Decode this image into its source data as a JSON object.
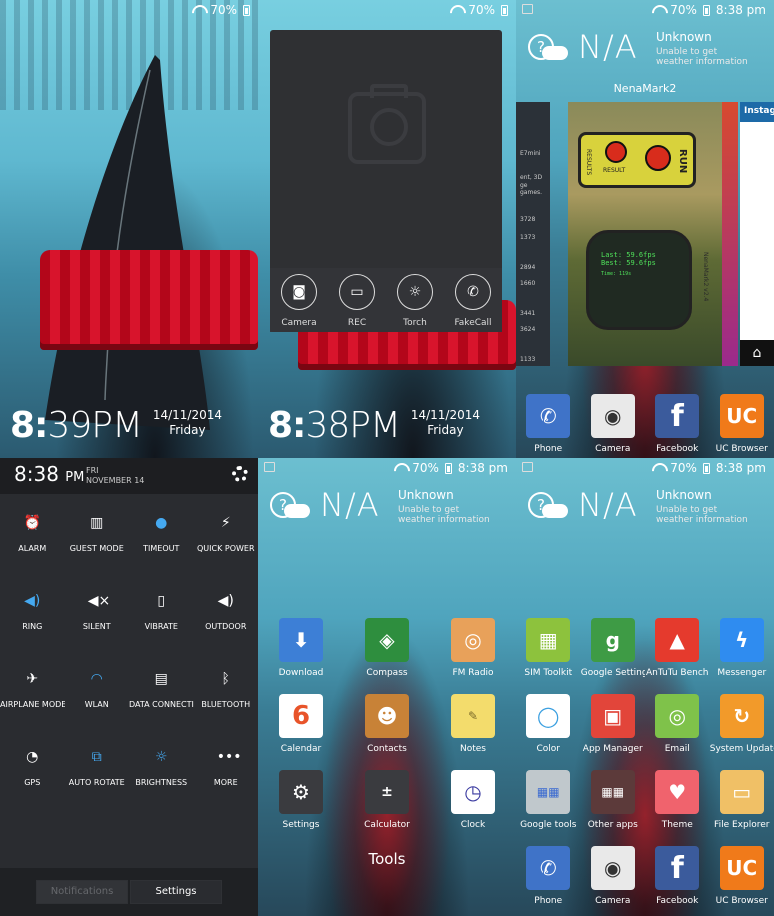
{
  "panel1": {
    "battery": "70%",
    "clock_h": "8:",
    "clock_rest": "39PM",
    "date": "14/11/2014",
    "day": "Friday"
  },
  "panel2": {
    "battery": "70%",
    "clock_h": "8:",
    "clock_rest": "38PM",
    "date": "14/11/2014",
    "day": "Friday",
    "actions": [
      {
        "label": "Camera",
        "icon": "camera-icon"
      },
      {
        "label": "REC",
        "icon": "recorder-icon"
      },
      {
        "label": "Torch",
        "icon": "torch-icon"
      },
      {
        "label": "FakeCall",
        "icon": "fake-call-icon"
      }
    ]
  },
  "panel3": {
    "battery": "70%",
    "time": "8:38 pm",
    "weather": {
      "temp": "N/A",
      "location": "Unknown",
      "message": "Unable to get weather information"
    },
    "recents_title": "NenaMark2",
    "left_card": {
      "label": "E7mini",
      "desc": "ent, 3D",
      "desc2": "ge games.",
      "ticks": [
        "3728",
        "1373",
        "2894",
        "1660",
        "3441",
        "3624",
        "1133"
      ]
    },
    "main_card": {
      "sign_left": "RESULTS",
      "sign_mid": "RESULT",
      "sign_right": "RUN",
      "dial_side": "NenaMark2 v2.4",
      "dial_line1": "Last: 59.6fps",
      "dial_line2": "Best: 59.6fps",
      "dial_small": "Time: 119s"
    },
    "right_card": {
      "title": "Instag"
    },
    "dock": [
      {
        "label": "Phone",
        "icon": "phone-icon",
        "color": "#3f73c8"
      },
      {
        "label": "Camera",
        "icon": "camera-icon",
        "color": "#e9e9e9"
      },
      {
        "label": "Facebook",
        "icon": "facebook-icon",
        "color": "#3b5b9c"
      },
      {
        "label": "UC Browser",
        "icon": "uc-browser-icon",
        "color": "#f07a1a"
      }
    ]
  },
  "panel4": {
    "time": "8:38",
    "ampm": "PM",
    "day": "FRI",
    "date": "NOVEMBER 14",
    "tiles": [
      [
        {
          "label": "ALARM",
          "icon": "alarm-icon",
          "on": false
        },
        {
          "label": "GUEST MODE",
          "icon": "guest-mode-icon",
          "on": false
        },
        {
          "label": "TIMEOUT",
          "icon": "timeout-icon",
          "on": true
        },
        {
          "label": "QUICK POWER",
          "icon": "quick-power-icon",
          "on": false
        }
      ],
      [
        {
          "label": "RING",
          "icon": "ring-icon",
          "on": true
        },
        {
          "label": "SILENT",
          "icon": "silent-icon",
          "on": false
        },
        {
          "label": "VIBRATE",
          "icon": "vibrate-icon",
          "on": false
        },
        {
          "label": "OUTDOOR",
          "icon": "outdoor-icon",
          "on": false
        }
      ],
      [
        {
          "label": "AIRPLANE MODE",
          "icon": "airplane-icon",
          "on": false
        },
        {
          "label": "WLAN",
          "icon": "wlan-icon",
          "on": true
        },
        {
          "label": "DATA CONNECTION",
          "icon": "data-connection-icon",
          "on": false
        },
        {
          "label": "BLUETOOTH",
          "icon": "bluetooth-icon",
          "on": false
        }
      ],
      [
        {
          "label": "GPS",
          "icon": "gps-icon",
          "on": false
        },
        {
          "label": "AUTO ROTATE",
          "icon": "auto-rotate-icon",
          "on": true
        },
        {
          "label": "BRIGHTNESS",
          "icon": "brightness-icon",
          "on": true
        },
        {
          "label": "MORE",
          "icon": "more-icon",
          "on": false
        }
      ]
    ],
    "tabs": [
      "Notifications",
      "Settings"
    ]
  },
  "panel5": {
    "battery": "70%",
    "time": "8:38 pm",
    "weather": {
      "temp": "N/A",
      "location": "Unknown",
      "message": "Unable to get weather information"
    },
    "folder_title": "Tools",
    "apps": [
      [
        {
          "label": "Download",
          "icon": "download-icon",
          "color": "#3d7fd6"
        },
        {
          "label": "Compass",
          "icon": "compass-icon",
          "color": "#2e8e3e"
        },
        {
          "label": "FM Radio",
          "icon": "fm-radio-icon",
          "color": "#e8a15a"
        }
      ],
      [
        {
          "label": "Calendar",
          "icon": "calendar-icon",
          "color": "#ffffff"
        },
        {
          "label": "Contacts",
          "icon": "contacts-icon",
          "color": "#c88237"
        },
        {
          "label": "Notes",
          "icon": "notes-icon",
          "color": "#f3dc6c"
        }
      ],
      [
        {
          "label": "Settings",
          "icon": "settings-icon",
          "color": "#3a3b3f"
        },
        {
          "label": "Calculator",
          "icon": "calculator-icon",
          "color": "#3a3b3f"
        },
        {
          "label": "Clock",
          "icon": "clock-icon",
          "color": "#ffffff"
        }
      ]
    ]
  },
  "panel6": {
    "battery": "70%",
    "time": "8:38 pm",
    "weather": {
      "temp": "N/A",
      "location": "Unknown",
      "message": "Unable to get weather information"
    },
    "apps": [
      [
        {
          "label": "SIM Toolkit",
          "icon": "sim-toolkit-icon",
          "color": "#8dc23d"
        },
        {
          "label": "Google Settings",
          "icon": "google-settings-icon",
          "color": "#3e9b45"
        },
        {
          "label": "AnTuTu Bench",
          "icon": "antutu-icon",
          "color": "#e53a2d"
        },
        {
          "label": "Messenger",
          "icon": "messenger-icon",
          "color": "#2f8cf0"
        }
      ],
      [
        {
          "label": "Color",
          "icon": "color-icon",
          "color": "#ffffff"
        },
        {
          "label": "App Manager",
          "icon": "app-manager-icon",
          "color": "#e2453a"
        },
        {
          "label": "Email",
          "icon": "email-icon",
          "color": "#7fc24a"
        },
        {
          "label": "System Update",
          "icon": "system-update-icon",
          "color": "#f29a2a"
        }
      ],
      [
        {
          "label": "Google tools",
          "icon": "google-tools-folder-icon",
          "color": "#c0c8cc"
        },
        {
          "label": "Other apps",
          "icon": "other-apps-folder-icon",
          "color": "#5c3a3a"
        },
        {
          "label": "Theme",
          "icon": "theme-icon",
          "color": "#f0636d"
        },
        {
          "label": "File Explorer",
          "icon": "file-explorer-icon",
          "color": "#f0c066"
        }
      ],
      [
        {
          "label": "Phone",
          "icon": "phone-icon",
          "color": "#3f73c8"
        },
        {
          "label": "Camera",
          "icon": "camera-icon",
          "color": "#e9e9e9"
        },
        {
          "label": "Facebook",
          "icon": "facebook-icon",
          "color": "#3b5b9c"
        },
        {
          "label": "UC Browser",
          "icon": "uc-browser-icon",
          "color": "#f07a1a"
        }
      ]
    ]
  }
}
